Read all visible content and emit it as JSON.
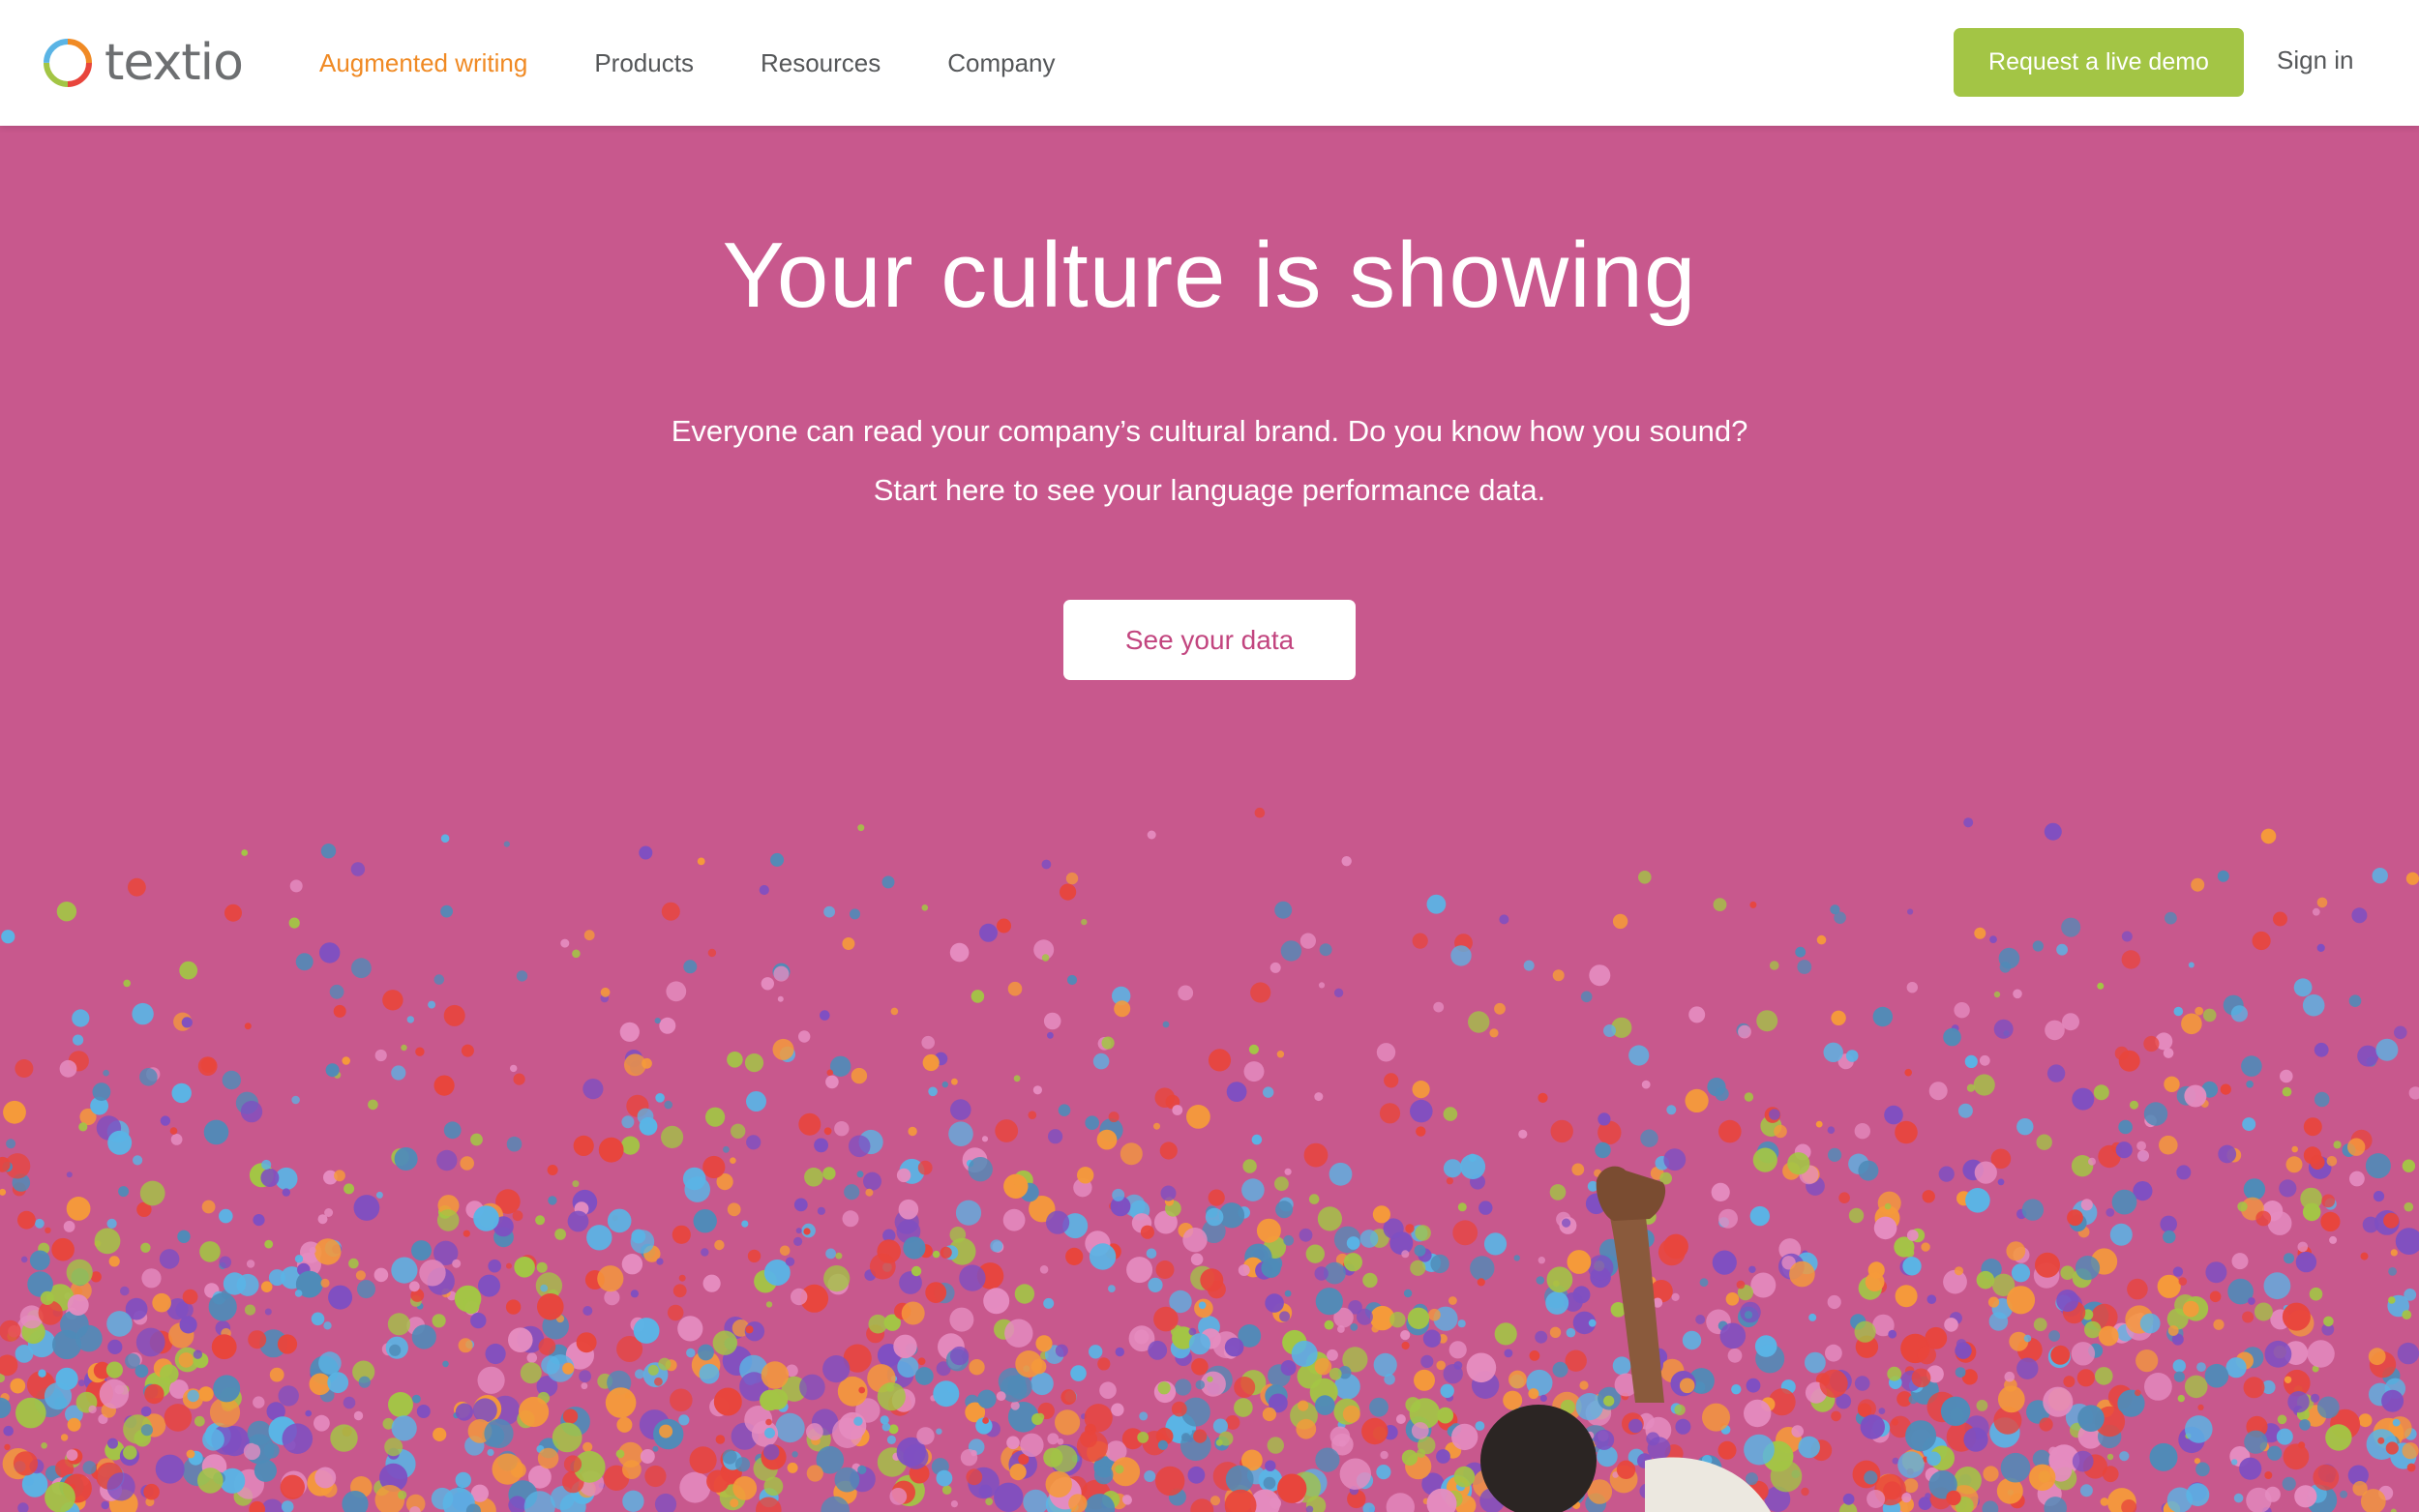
{
  "header": {
    "logo_text": "textio",
    "nav": [
      {
        "label": "Augmented writing",
        "active": true
      },
      {
        "label": "Products",
        "active": false
      },
      {
        "label": "Resources",
        "active": false
      },
      {
        "label": "Company",
        "active": false
      }
    ],
    "demo_button_label": "Request a live demo",
    "signin_label": "Sign in"
  },
  "hero": {
    "title": "Your culture is showing",
    "subtitle_line1": "Everyone can read your company’s cultural brand. Do you know how you sound?",
    "subtitle_line2": "Start here to see your language performance data.",
    "cta_label": "See your data"
  },
  "colors": {
    "hero_background": "#c8588d",
    "accent_orange": "#f08a24",
    "demo_green": "#a3c545",
    "confetti": [
      "#e8453c",
      "#f59a3a",
      "#a3c545",
      "#5ab4e5",
      "#7e4fc2",
      "#4f8bb8",
      "#e58cc0"
    ]
  }
}
